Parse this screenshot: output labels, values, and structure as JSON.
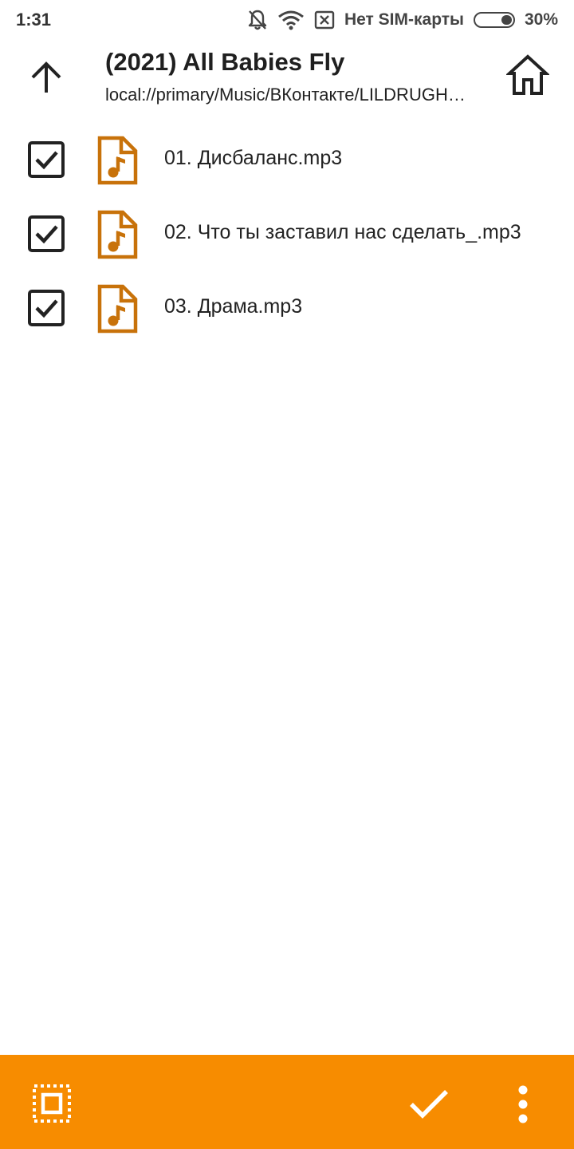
{
  "status_bar": {
    "time": "1:31",
    "carrier": "Нет SIM-карты",
    "battery_percent": "30%",
    "battery_level": 0.3,
    "icons": [
      "mute-icon",
      "wifi-icon",
      "no-sim-icon",
      "battery-icon"
    ]
  },
  "header": {
    "title": "(2021) All Babies Fly",
    "path": "local://primary/Music/ВКонтакте/LILDRUGHILL",
    "up_icon": "arrow-up-icon",
    "home_icon": "home-icon"
  },
  "files": [
    {
      "name": "01. Дисбаланс.mp3",
      "checked": true,
      "icon": "audio-file-icon"
    },
    {
      "name": "02. Что ты заставил нас сделать_.mp3",
      "checked": true,
      "icon": "audio-file-icon"
    },
    {
      "name": "03. Драма.mp3",
      "checked": true,
      "icon": "audio-file-icon"
    }
  ],
  "bottom_bar": {
    "icons": [
      "select-all-icon",
      "check-icon",
      "more-vert-icon"
    ]
  },
  "colors": {
    "accent": "#f78c00",
    "file_icon": "#c8720a",
    "text": "#222222",
    "background": "#ffffff"
  }
}
